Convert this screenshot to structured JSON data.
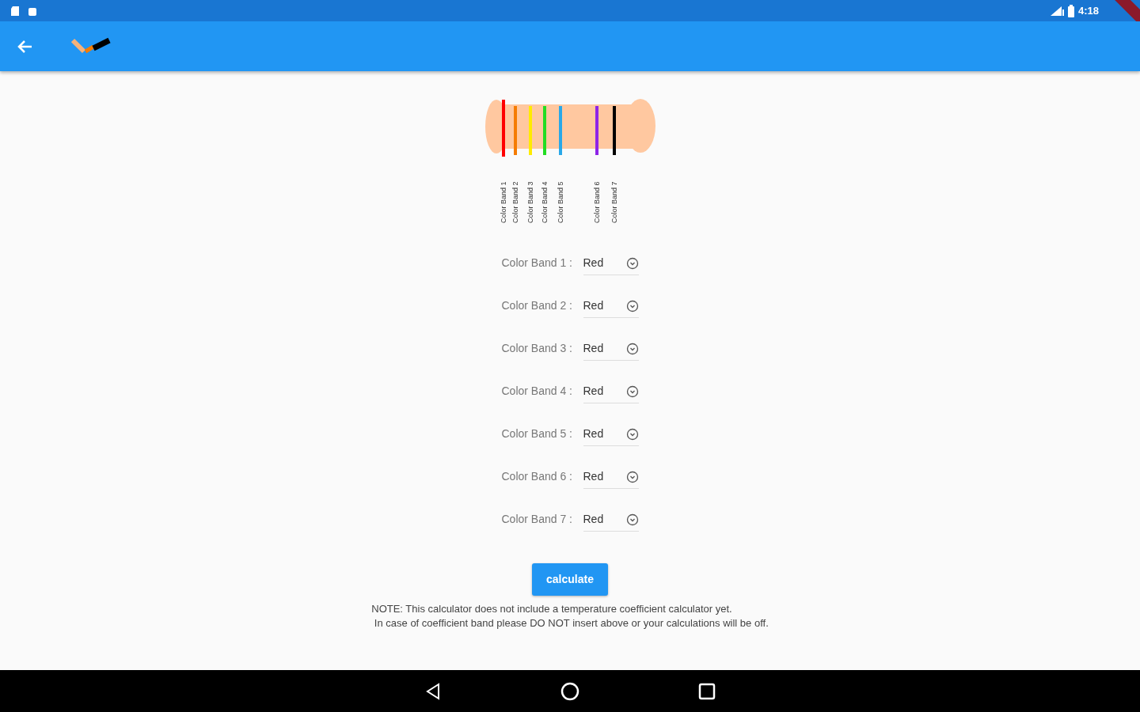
{
  "status_bar": {
    "time": "4:18"
  },
  "resistor": {
    "bands": [
      {
        "label": "Color Band 1",
        "color": "#ff0000"
      },
      {
        "label": "Color Band 2",
        "color": "#f57c00"
      },
      {
        "label": "Color Band 3",
        "color": "#ffeb00"
      },
      {
        "label": "Color Band 4",
        "color": "#22dd22"
      },
      {
        "label": "Color Band 5",
        "color": "#29a8e8"
      },
      {
        "label": "Color Band 6",
        "color": "#8e24e8"
      },
      {
        "label": "Color Band 7",
        "color": "#000000"
      }
    ]
  },
  "selectors": [
    {
      "label": "Color Band 1 :",
      "value": "Red"
    },
    {
      "label": "Color Band 2 :",
      "value": "Red"
    },
    {
      "label": "Color Band 3 :",
      "value": "Red"
    },
    {
      "label": "Color Band 4 :",
      "value": "Red"
    },
    {
      "label": "Color Band 5 :",
      "value": "Red"
    },
    {
      "label": "Color Band 6 :",
      "value": "Red"
    },
    {
      "label": "Color Band 7 :",
      "value": "Red"
    }
  ],
  "calculate_button": "calculate",
  "note": [
    "NOTE: This calculator does not include a temperature coefficient calculator yet.",
    " In case of coefficient band please DO NOT insert above or your calculations will be off."
  ]
}
